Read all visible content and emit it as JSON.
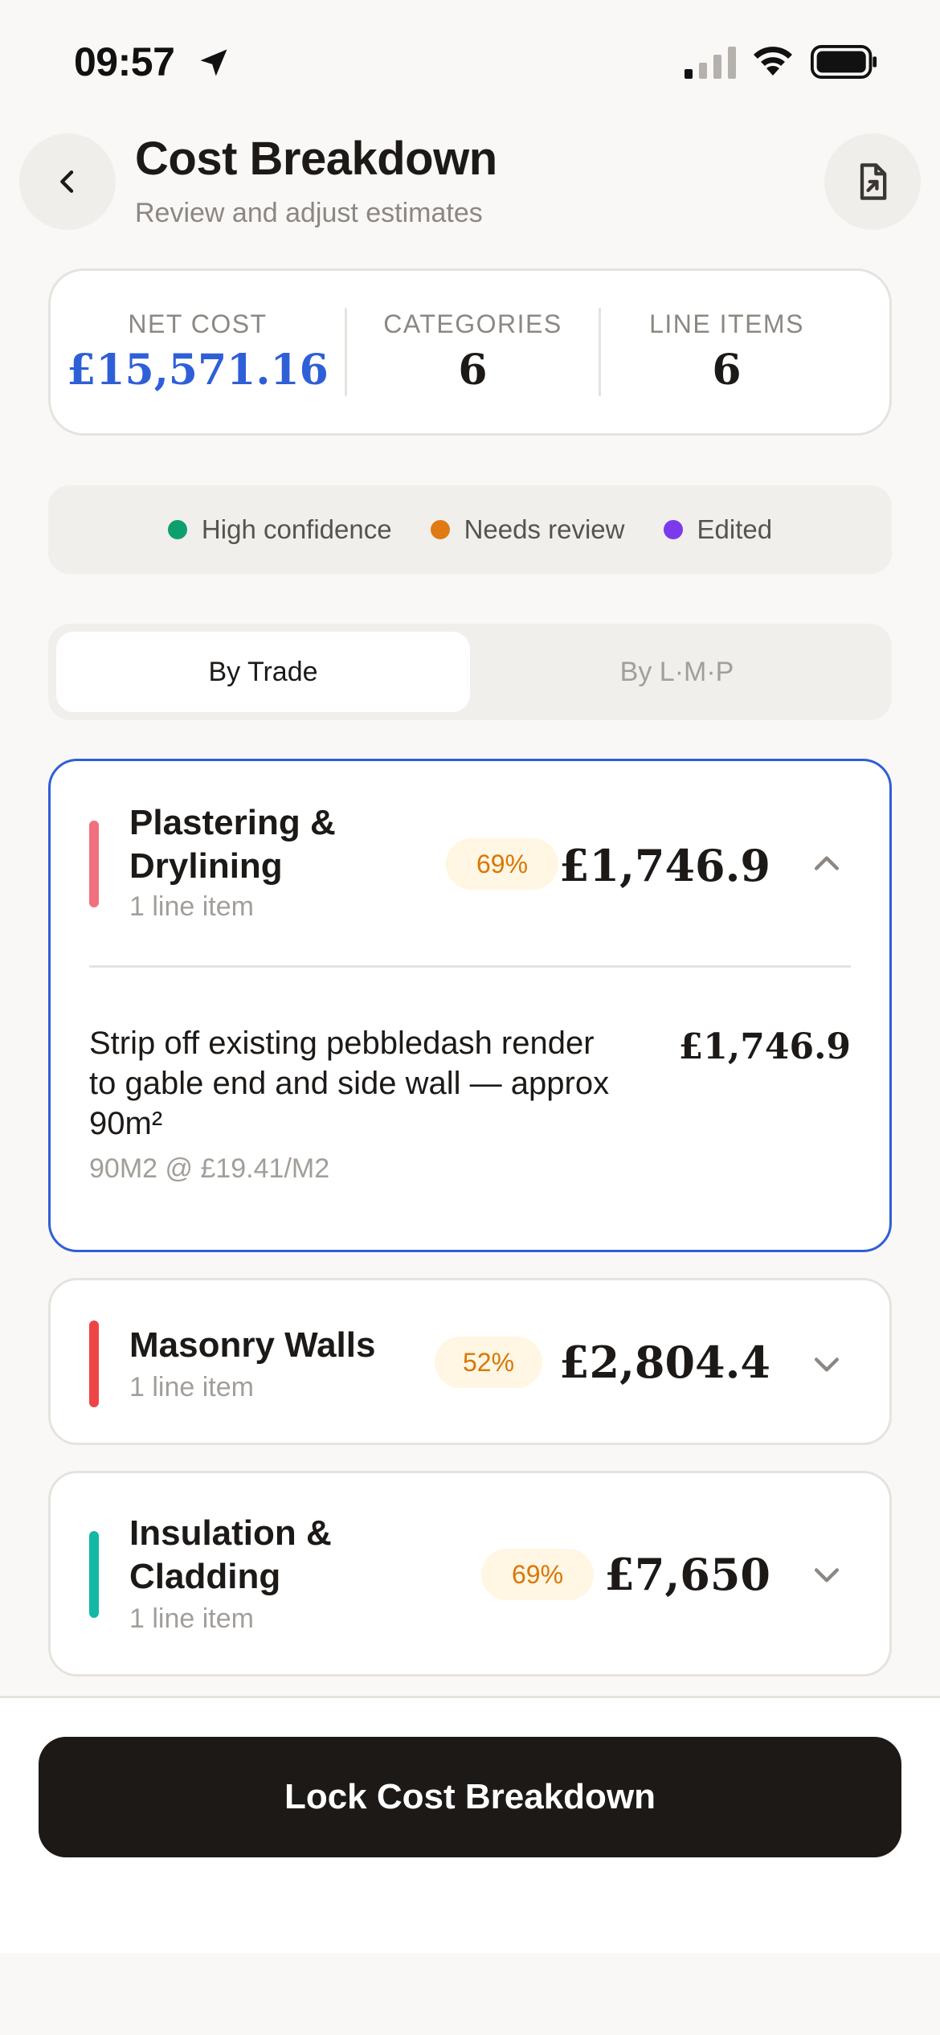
{
  "status_bar": {
    "time": "09:57"
  },
  "header": {
    "title": "Cost Breakdown",
    "subtitle": "Review and adjust estimates"
  },
  "summary": {
    "net_cost_label": "NET COST",
    "net_cost_value": "£15,571.16",
    "categories_label": "CATEGORIES",
    "categories_value": "6",
    "line_items_label": "LINE ITEMS",
    "line_items_value": "6"
  },
  "legend": [
    {
      "label": "High confidence",
      "color": "#0e9f6e"
    },
    {
      "label": "Needs review",
      "color": "#e07b12"
    },
    {
      "label": "Edited",
      "color": "#7c3aed"
    }
  ],
  "tabs": [
    {
      "label": "By Trade",
      "active": true
    },
    {
      "label": "By L·M·P",
      "active": false
    }
  ],
  "trades": [
    {
      "name_line1": "Plastering &",
      "name_line2": "Drylining",
      "count": "1 line item",
      "confidence": "69%",
      "confidence_level": 0.69,
      "total": "£1,746.9",
      "color": "#f0707f",
      "expanded": true,
      "line_item": {
        "description_line1": "Strip off existing pebbledash render",
        "description_line2": "to gable end and side wall — approx",
        "description_line3": "90m²",
        "quantity": "90M2 @ £19.41/M2",
        "amount": "£1,746.9"
      }
    },
    {
      "name_line1": "Masonry Walls",
      "count": "1 line item",
      "confidence": "52%",
      "confidence_level": 0.52,
      "total": "£2,804.4",
      "color": "#ef4444",
      "expanded": false
    },
    {
      "name_line1": "Insulation &",
      "name_line2": "Cladding",
      "count": "1 line item",
      "confidence": "69%",
      "confidence_level": 0.69,
      "total": "£7,650",
      "color": "#14b8a6",
      "expanded": false
    }
  ],
  "footer": {
    "lock_label": "Lock Cost Breakdown"
  },
  "colors": {
    "accent": "#2f5fd7",
    "badge_text": "#d97706",
    "badge_bg": "#fff6e3",
    "primary_button": "#1c1917"
  },
  "icons": {
    "back": "chevron-left-icon",
    "export": "file-export-icon",
    "collapse": "chevron-up-icon",
    "expand": "chevron-down-icon"
  }
}
